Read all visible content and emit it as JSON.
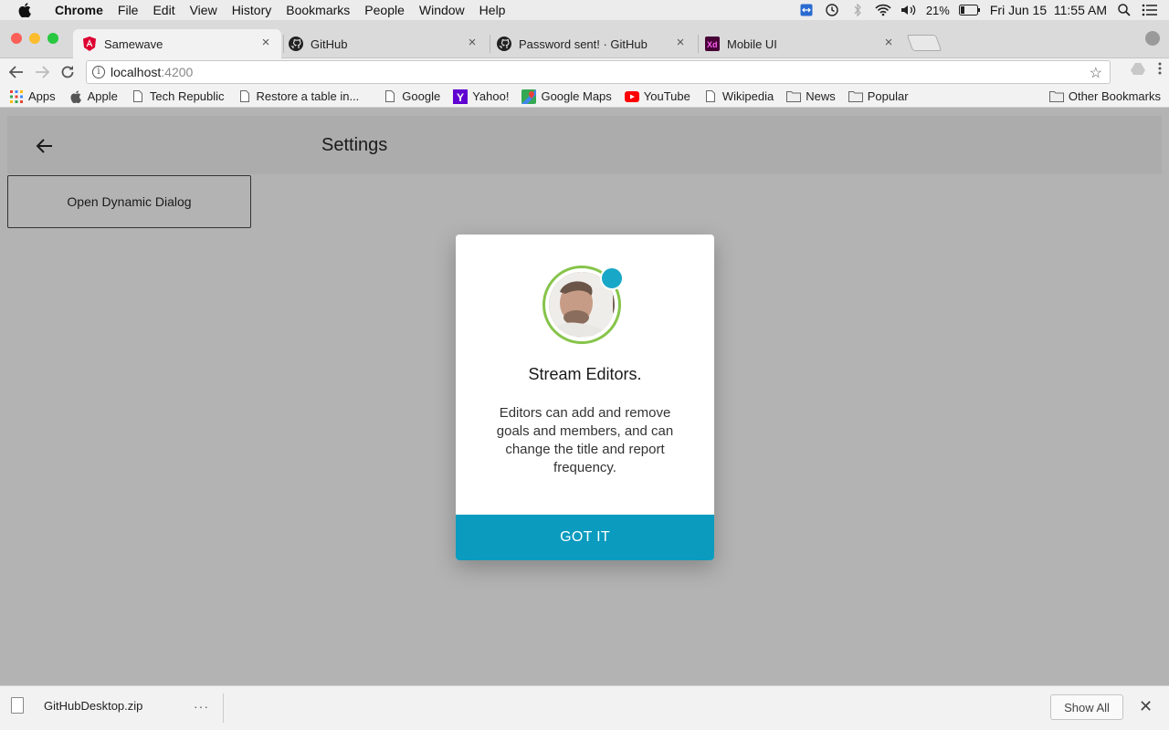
{
  "menubar": {
    "app": "Chrome",
    "items": [
      "File",
      "Edit",
      "View",
      "History",
      "Bookmarks",
      "People",
      "Window",
      "Help"
    ],
    "battery": "21%",
    "datetime": "Fri Jun 15  11:55 AM"
  },
  "tabs": [
    {
      "title": "Samewave",
      "icon": "angular-icon",
      "active": true
    },
    {
      "title": "GitHub",
      "icon": "github-icon",
      "active": false
    },
    {
      "title": "Password sent! · GitHub",
      "icon": "github-icon",
      "active": false
    },
    {
      "title": "Mobile UI",
      "icon": "adobe-xd-icon",
      "active": false
    }
  ],
  "address": {
    "host": "localhost",
    "port": ":4200"
  },
  "bookmarks": [
    {
      "label": "Apps",
      "icon": "apps-grid-icon"
    },
    {
      "label": "Apple",
      "icon": "apple-icon"
    },
    {
      "label": "Tech Republic",
      "icon": "page-icon"
    },
    {
      "label": "Restore a table in...",
      "icon": "page-icon"
    },
    {
      "label": "Google",
      "icon": "page-icon"
    },
    {
      "label": "Yahoo!",
      "icon": "yahoo-icon"
    },
    {
      "label": "Google Maps",
      "icon": "google-maps-icon"
    },
    {
      "label": "YouTube",
      "icon": "youtube-icon"
    },
    {
      "label": "Wikipedia",
      "icon": "page-icon"
    },
    {
      "label": "News",
      "icon": "folder-icon"
    },
    {
      "label": "Popular",
      "icon": "folder-icon"
    }
  ],
  "other_bookmarks": "Other Bookmarks",
  "app": {
    "header_title": "Settings",
    "open_dialog_label": "Open Dynamic Dialog"
  },
  "dialog": {
    "title": "Stream Editors.",
    "body": "Editors can add and remove goals and members, and can change the title and report frequency.",
    "button": "GOT IT",
    "accent": "#0a9bbf",
    "ring_color": "#86c44a",
    "status_color": "#19a7c8"
  },
  "downloads": {
    "filename": "GitHubDesktop.zip",
    "more": "···",
    "show_all": "Show All"
  }
}
